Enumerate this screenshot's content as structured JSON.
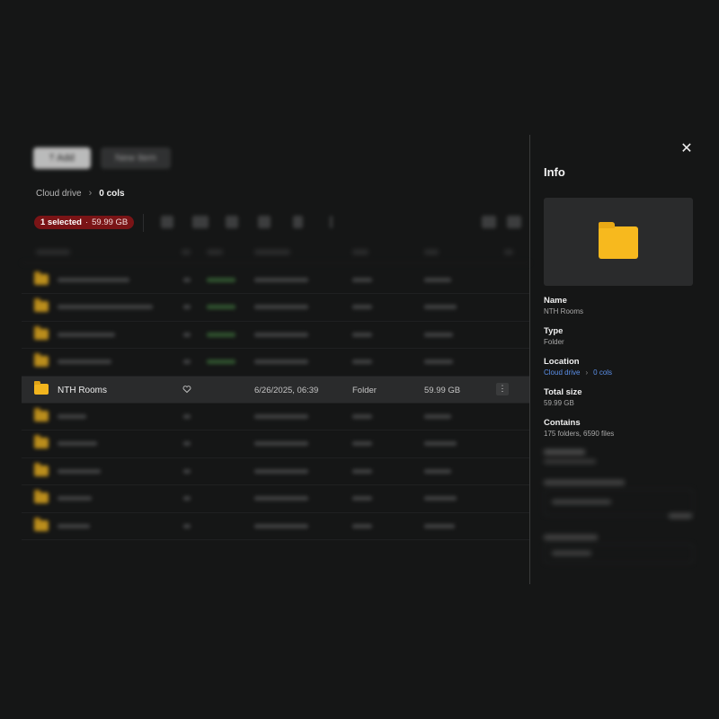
{
  "toolbar": {
    "upload_label": "Add",
    "new_label": "New item"
  },
  "breadcrumb": {
    "root": "Cloud drive",
    "current": "0 cols"
  },
  "selection": {
    "count_text": "1 selected",
    "size_text": "59.99 GB"
  },
  "table": {
    "selected_row": {
      "name": "NTH Rooms",
      "modified": "6/26/2025, 06:39",
      "type": "Folder",
      "size": "59.99 GB"
    }
  },
  "info": {
    "title": "Info",
    "name_label": "Name",
    "name_value": "NTH Rooms",
    "type_label": "Type",
    "type_value": "Folder",
    "location_label": "Location",
    "location_root": "Cloud drive",
    "location_current": "0 cols",
    "size_label": "Total size",
    "size_value": "59.99 GB",
    "contains_label": "Contains",
    "contains_value": "175 folders, 6590 files"
  },
  "colors": {
    "accent_folder": "#f2b51e",
    "badge_bg": "#7a1416",
    "link": "#5b8fe8",
    "background": "#151616"
  }
}
